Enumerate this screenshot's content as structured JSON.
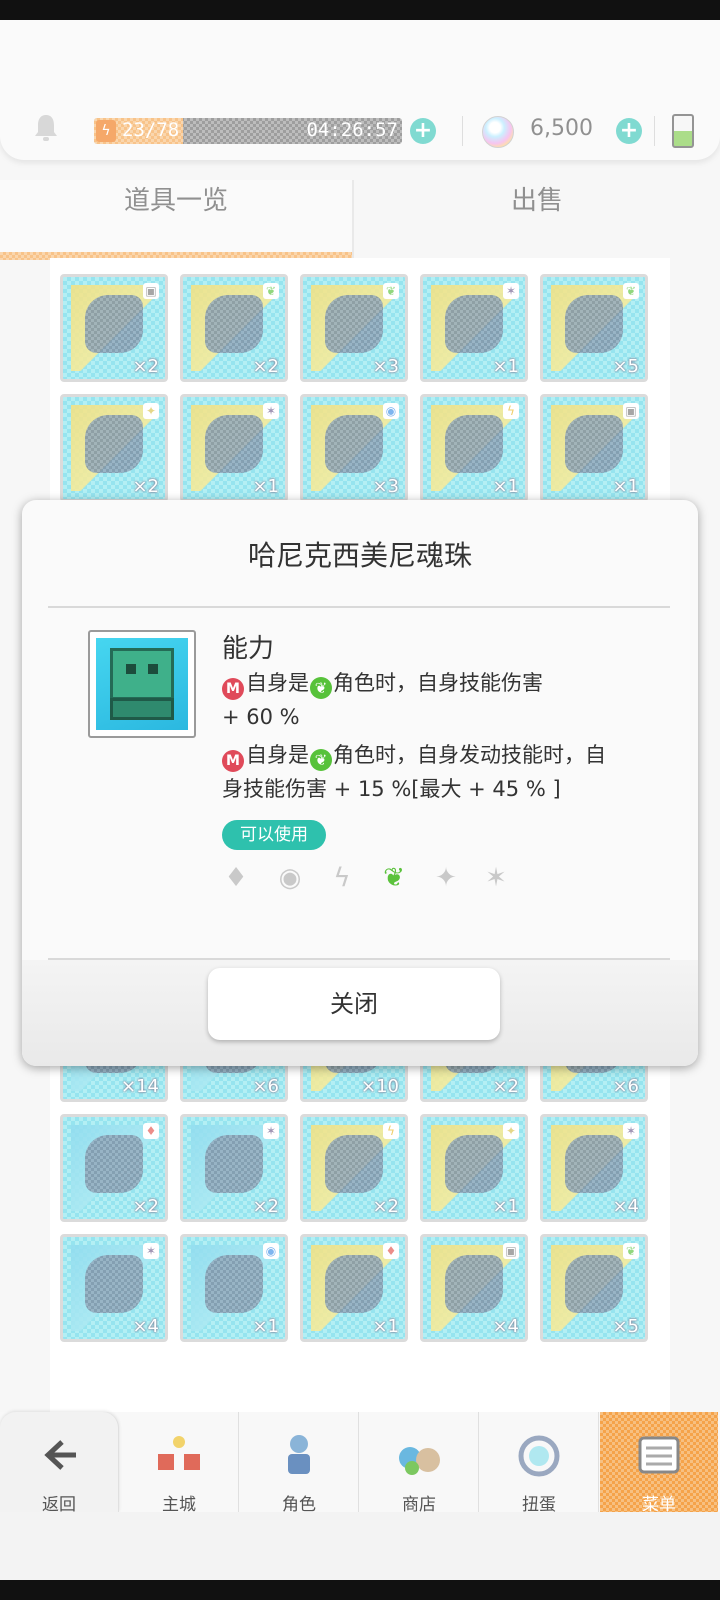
{
  "topbar": {
    "stamina_count": "23/78",
    "stamina_fraction": 0.29,
    "stamina_timer": "04:26:57",
    "gems": "6,500"
  },
  "tabs": [
    {
      "label": "道具一览",
      "active": true
    },
    {
      "label": "出售",
      "active": false
    }
  ],
  "grid": {
    "rows_top": [
      [
        {
          "qty": "×2",
          "badge": "qr"
        },
        {
          "qty": "×2",
          "badge": "leaf"
        },
        {
          "qty": "×3",
          "badge": "leaf"
        },
        {
          "qty": "×1",
          "badge": "shuriken"
        },
        {
          "qty": "×5",
          "badge": "leaf"
        }
      ],
      [
        {
          "qty": "×2",
          "badge": "star"
        },
        {
          "qty": "×1",
          "badge": "shuriken"
        },
        {
          "qty": "×3",
          "badge": "circle"
        },
        {
          "qty": "×1",
          "badge": "bolt"
        },
        {
          "qty": "×1",
          "badge": "qr"
        }
      ]
    ],
    "rows_partial": [
      [
        {
          "qty": "×14"
        },
        {
          "qty": "×6"
        },
        {
          "qty": "×10"
        },
        {
          "qty": "×2"
        },
        {
          "qty": "×6"
        }
      ]
    ],
    "rows_bottom": [
      [
        {
          "qty": "×2",
          "badge": "fire"
        },
        {
          "qty": "×2",
          "badge": "shuriken"
        },
        {
          "qty": "×2",
          "badge": "bolt"
        },
        {
          "qty": "×1",
          "badge": "star"
        },
        {
          "qty": "×4",
          "badge": "shuriken"
        }
      ],
      [
        {
          "qty": "×4",
          "badge": "shuriken"
        },
        {
          "qty": "×1",
          "badge": "circle"
        },
        {
          "qty": "×1",
          "badge": "fire"
        },
        {
          "qty": "×4",
          "badge": "qr"
        },
        {
          "qty": "×5",
          "badge": "leaf"
        }
      ]
    ]
  },
  "modal": {
    "title": "哈尼克西美尼魂珠",
    "ability_label": "能力",
    "line1_text": "自身是",
    "line1_text2": "角色时，自身技能伤害",
    "line1_value": "+ 60 %",
    "line2_text": "自身是",
    "line2_text2": "角色时，自身发动技能时，自",
    "line2_text3": "身技能伤害 + 15 %[最大 + 45 % ]",
    "usable_badge": "可以使用",
    "m_icon": "M",
    "attributes": [
      {
        "icon": "fire-icon",
        "glyph": "♦",
        "active": false
      },
      {
        "icon": "orb-icon",
        "glyph": "◉",
        "active": false
      },
      {
        "icon": "bolt-icon",
        "glyph": "ϟ",
        "active": false
      },
      {
        "icon": "leaf-icon",
        "glyph": "❦",
        "active": true
      },
      {
        "icon": "star-icon",
        "glyph": "✦",
        "active": false
      },
      {
        "icon": "shuriken-icon",
        "glyph": "✶",
        "active": false
      }
    ],
    "close_label": "关闭"
  },
  "bottomnav": [
    {
      "label": "返回",
      "icon": "back-arrow-icon"
    },
    {
      "label": "主城",
      "icon": "town-icon"
    },
    {
      "label": "角色",
      "icon": "character-icon"
    },
    {
      "label": "商店",
      "icon": "shop-icon"
    },
    {
      "label": "扭蛋",
      "icon": "gacha-icon"
    },
    {
      "label": "菜单",
      "icon": "menu-icon"
    }
  ],
  "colors": {
    "accent_orange": "#f5a34a",
    "teal": "#2ec1ad",
    "leaf_green": "#57c23a",
    "m_red": "#e04a5a"
  }
}
